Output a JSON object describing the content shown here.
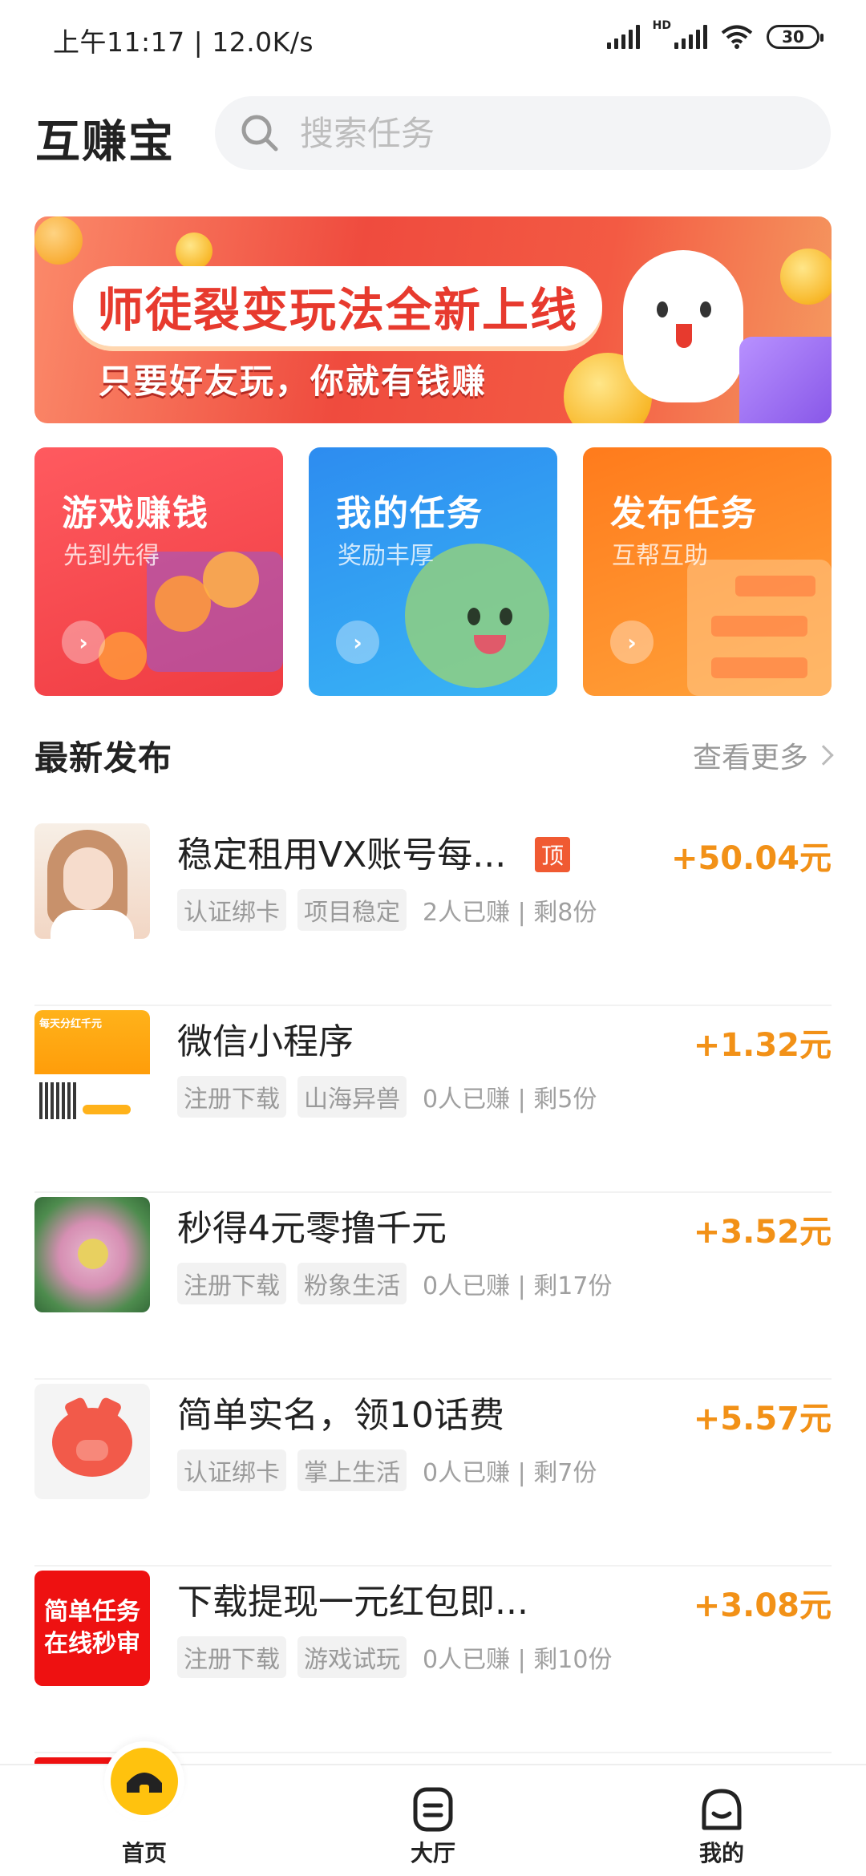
{
  "status_bar": {
    "time": "上午11:17 | 12.0K/s",
    "hd": "HD",
    "battery": "30"
  },
  "header": {
    "title": "互赚宝",
    "search_placeholder": "搜索任务"
  },
  "banner": {
    "title": "师徒裂变玩法全新上线",
    "subtitle": "只要好友玩，你就有钱赚"
  },
  "cards": [
    {
      "title": "游戏赚钱",
      "subtitle": "先到先得",
      "color": "#f04449"
    },
    {
      "title": "我的任务",
      "subtitle": "奖励丰厚",
      "color": "#2f8ff0"
    },
    {
      "title": "发布任务",
      "subtitle": "互帮互助",
      "color": "#ff8a25"
    }
  ],
  "section": {
    "title": "最新发布",
    "see_more": "查看更多"
  },
  "tasks": [
    {
      "title": "稳定租用VX账号每...",
      "top_badge": "顶",
      "price": "+50.04元",
      "tags": [
        "认证绑卡",
        "项目稳定"
      ],
      "meta": "2人已赚 | 剩8份",
      "thumb": "portrait-photo"
    },
    {
      "title": "微信小程序",
      "price": "+1.32元",
      "tags": [
        "注册下载",
        "山海异兽"
      ],
      "meta": "0人已赚 | 剩5份",
      "thumb": "qr-poster",
      "thumb_text": "每天分红千元"
    },
    {
      "title": "秒得4元零撸千元",
      "price": "+3.52元",
      "tags": [
        "注册下载",
        "粉象生活"
      ],
      "meta": "0人已赚 | 剩17份",
      "thumb": "lotus-photo"
    },
    {
      "title": "简单实名，领10话费",
      "price": "+5.57元",
      "tags": [
        "认证绑卡",
        "掌上生活"
      ],
      "meta": "0人已赚 | 剩7份",
      "thumb": "pig-icon"
    },
    {
      "title": "下载提现一元红包即...",
      "price": "+3.08元",
      "tags": [
        "注册下载",
        "游戏试玩"
      ],
      "meta": "0人已赚 | 剩10份",
      "thumb": "red-text-logo",
      "thumb_text": [
        "简单任务",
        "在线秒审"
      ]
    }
  ],
  "nav": {
    "home": "首页",
    "hall": "大厅",
    "mine": "我的"
  },
  "colors": {
    "accent": "#f29117",
    "home_active": "#ffc20e",
    "badge": "#f05a32"
  }
}
